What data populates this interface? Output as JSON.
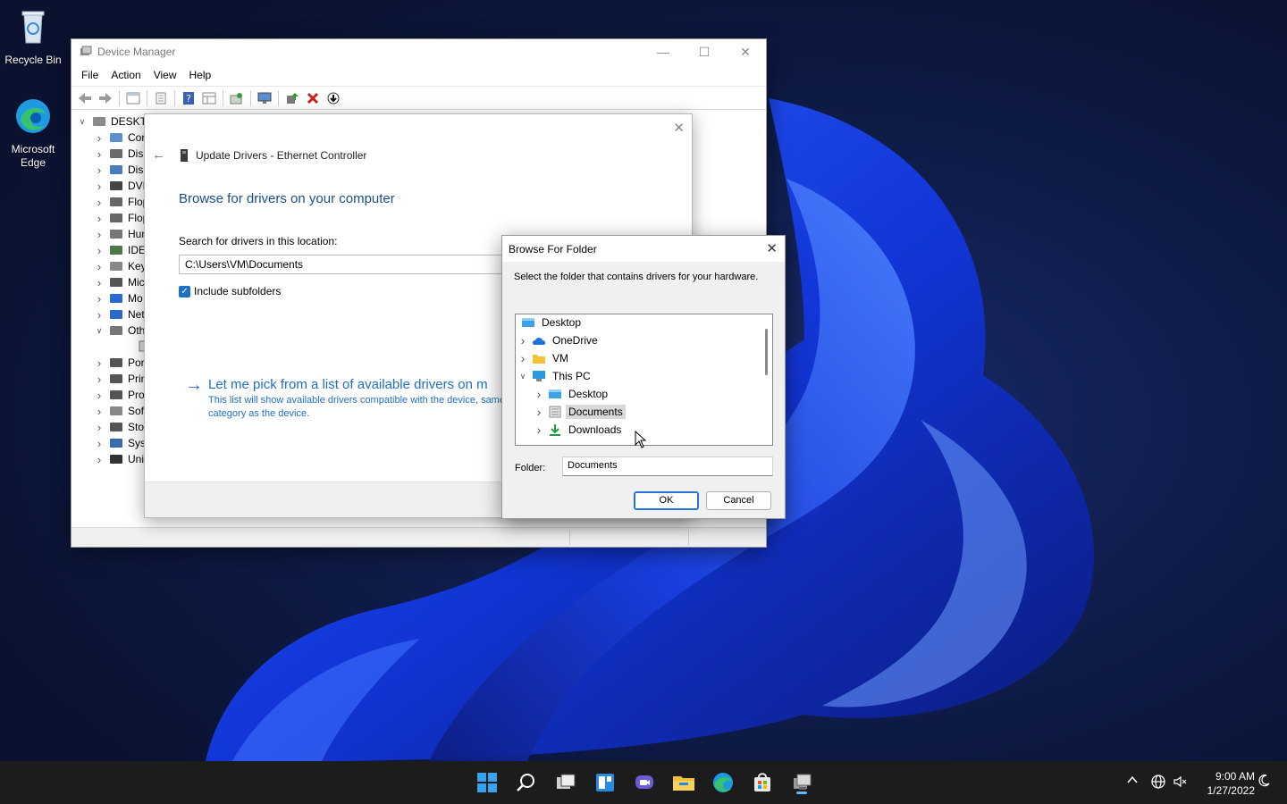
{
  "desktop": {
    "icons": [
      {
        "label": "Recycle Bin",
        "icon": "recycle-bin-icon"
      },
      {
        "label": "Microsoft Edge",
        "icon": "edge-icon"
      }
    ]
  },
  "device_manager": {
    "title": "Device Manager",
    "menu": [
      "File",
      "Action",
      "View",
      "Help"
    ],
    "tree": [
      {
        "label": "DESKTO",
        "expanded": true
      },
      {
        "label": "Cor"
      },
      {
        "label": "Disk"
      },
      {
        "label": "Disp"
      },
      {
        "label": "DVD"
      },
      {
        "label": "Flop"
      },
      {
        "label": "Flop"
      },
      {
        "label": "Hum"
      },
      {
        "label": "IDE"
      },
      {
        "label": "Key"
      },
      {
        "label": "Mic"
      },
      {
        "label": "Mo"
      },
      {
        "label": "Net"
      },
      {
        "label": "Oth",
        "expanded": true
      },
      {
        "label": ""
      },
      {
        "label": "Por"
      },
      {
        "label": "Prin"
      },
      {
        "label": "Pro"
      },
      {
        "label": "Soft"
      },
      {
        "label": "Stor"
      },
      {
        "label": "Syst"
      },
      {
        "label": "Uni"
      }
    ]
  },
  "update_drivers": {
    "header": "Update Drivers - Ethernet Controller",
    "heading": "Browse for drivers on your computer",
    "search_label": "Search for drivers in this location:",
    "path_value": "C:\\Users\\VM\\Documents",
    "include_subfolders": "Include subfolders",
    "include_subfolders_checked": true,
    "pick_title": "Let me pick from a list of available drivers on m",
    "pick_desc": "This list will show available drivers compatible with the device, same category as the device."
  },
  "browse_folder": {
    "title": "Browse For Folder",
    "description": "Select the folder that contains drivers for your hardware.",
    "tree": [
      {
        "label": "Desktop",
        "level": 0,
        "chevron": "",
        "icon": "desktop-folder-icon"
      },
      {
        "label": "OneDrive",
        "level": 1,
        "chevron": "›",
        "icon": "onedrive-cloud-icon"
      },
      {
        "label": "VM",
        "level": 1,
        "chevron": "›",
        "icon": "user-folder-icon"
      },
      {
        "label": "This PC",
        "level": 1,
        "chevron": "⌄",
        "icon": "this-pc-icon"
      },
      {
        "label": "Desktop",
        "level": 2,
        "chevron": "›",
        "icon": "desktop-folder-icon"
      },
      {
        "label": "Documents",
        "level": 2,
        "chevron": "›",
        "icon": "documents-folder-icon",
        "selected": true
      },
      {
        "label": "Downloads",
        "level": 2,
        "chevron": "›",
        "icon": "downloads-folder-icon"
      }
    ],
    "folder_label": "Folder:",
    "folder_value": "Documents",
    "ok_label": "OK",
    "cancel_label": "Cancel"
  },
  "taskbar": {
    "apps": [
      "start-icon",
      "search-icon",
      "task-view-icon",
      "widgets-icon",
      "chat-icon",
      "file-explorer-icon",
      "edge-icon",
      "store-icon",
      "device-manager-icon"
    ],
    "time": "9:00 AM",
    "date": "1/27/2022"
  },
  "colors": {
    "accent": "#1f6fc5",
    "heading": "#1a4e8c",
    "taskbar": "#1c1c1c"
  }
}
